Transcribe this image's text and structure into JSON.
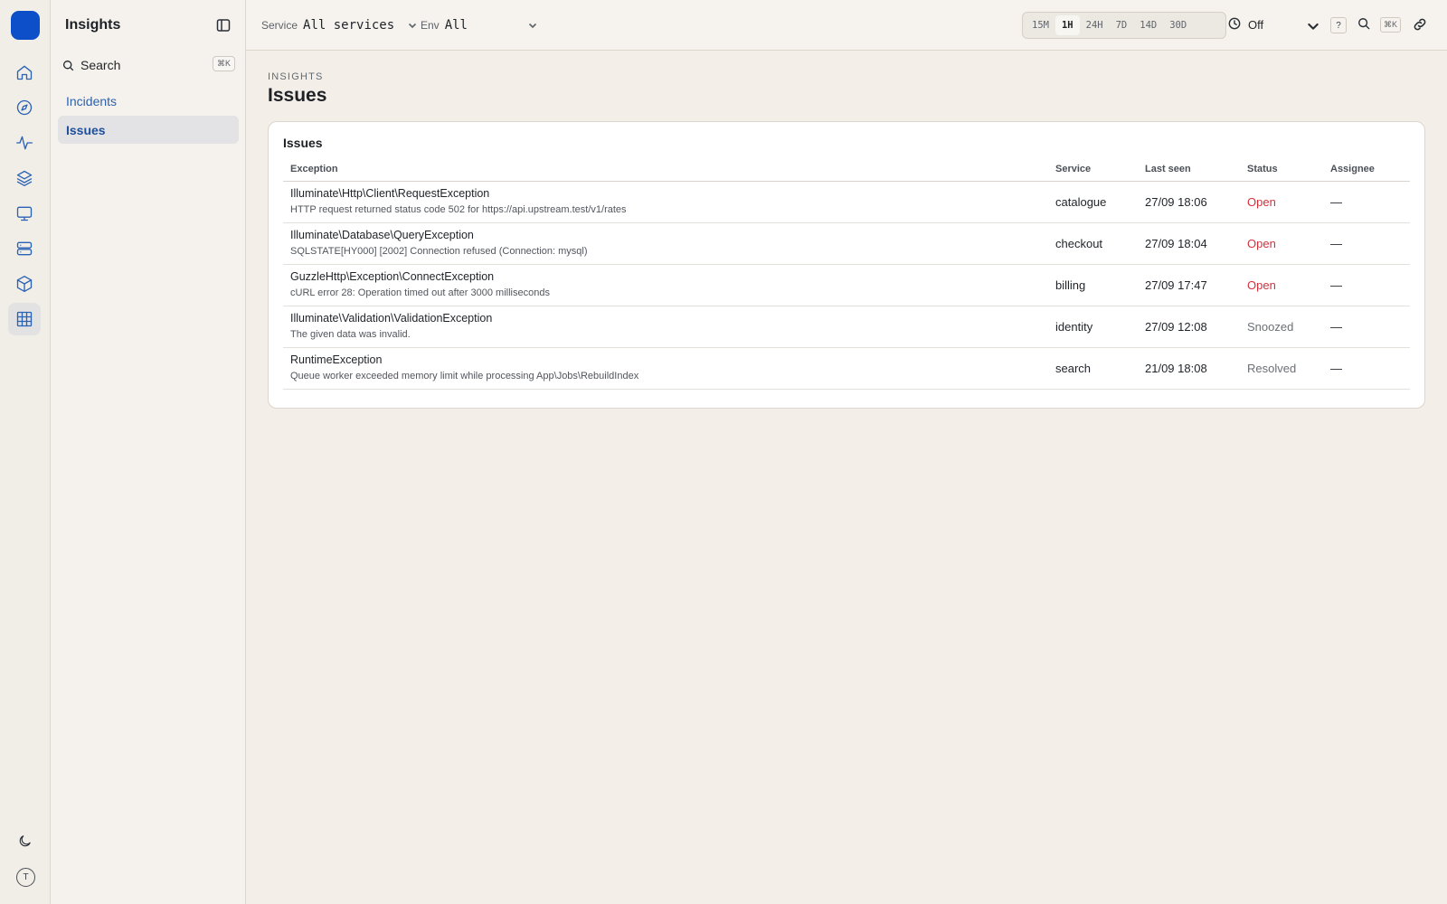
{
  "sidebar": {
    "title": "Insights",
    "search_label": "Search",
    "search_shortcut": "⌘K",
    "items": [
      {
        "label": "Incidents"
      },
      {
        "label": "Issues"
      }
    ]
  },
  "rail": {
    "avatar_initial": "T"
  },
  "topbar": {
    "service_label": "Service",
    "service_value": "All services",
    "env_label": "Env",
    "env_value": "All",
    "ranges": [
      "15M",
      "1H",
      "24H",
      "7D",
      "14D",
      "30D"
    ],
    "active_range": "1H",
    "refresh_value": "Off",
    "help_label": "?",
    "search_shortcut": "⌘K"
  },
  "page": {
    "eyebrow": "INSIGHTS",
    "title": "Issues"
  },
  "issues_card": {
    "title": "Issues",
    "columns": {
      "exception": "Exception",
      "service": "Service",
      "last_seen": "Last seen",
      "status": "Status",
      "assignee": "Assignee"
    },
    "rows": [
      {
        "exception": "Illuminate\\Http\\Client\\RequestException",
        "message": "HTTP request returned status code 502 for https://api.upstream.test/v1/rates",
        "service": "catalogue",
        "last_seen": "27/09 18:06",
        "status": "Open",
        "assignee": "—"
      },
      {
        "exception": "Illuminate\\Database\\QueryException",
        "message": "SQLSTATE[HY000] [2002] Connection refused (Connection: mysql)",
        "service": "checkout",
        "last_seen": "27/09 18:04",
        "status": "Open",
        "assignee": "—"
      },
      {
        "exception": "GuzzleHttp\\Exception\\ConnectException",
        "message": "cURL error 28: Operation timed out after 3000 milliseconds",
        "service": "billing",
        "last_seen": "27/09 17:47",
        "status": "Open",
        "assignee": "—"
      },
      {
        "exception": "Illuminate\\Validation\\ValidationException",
        "message": "The given data was invalid.",
        "service": "identity",
        "last_seen": "27/09 12:08",
        "status": "Snoozed",
        "assignee": "—"
      },
      {
        "exception": "RuntimeException",
        "message": "Queue worker exceeded memory limit while processing App\\Jobs\\RebuildIndex",
        "service": "search",
        "last_seen": "21/09 18:08",
        "status": "Resolved",
        "assignee": "—"
      }
    ]
  },
  "colors": {
    "accent": "#0d4fc8",
    "status_open": "#d0323c",
    "status_muted": "#6b7077"
  }
}
